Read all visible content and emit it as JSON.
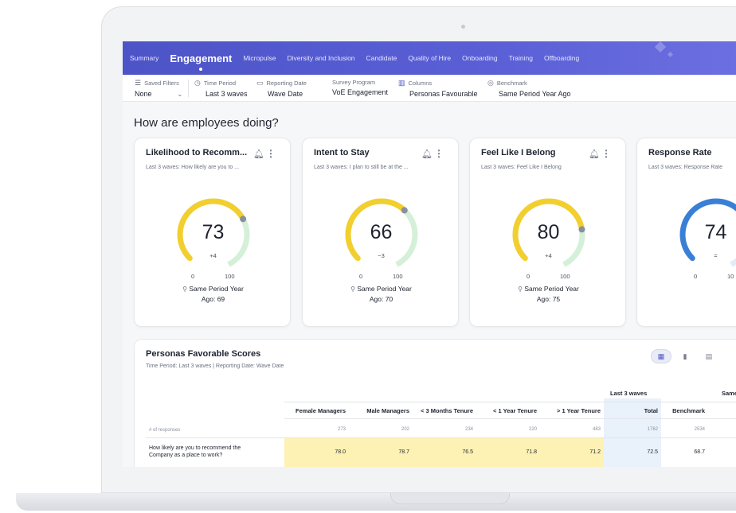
{
  "nav": {
    "items": [
      {
        "label": "Summary",
        "active": false
      },
      {
        "label": "Engagement",
        "active": true
      },
      {
        "label": "Micropulse",
        "active": false
      },
      {
        "label": "Diversity and Inclusion",
        "active": false
      },
      {
        "label": "Candidate",
        "active": false
      },
      {
        "label": "Quality of Hire",
        "active": false
      },
      {
        "label": "Onboarding",
        "active": false
      },
      {
        "label": "Training",
        "active": false
      },
      {
        "label": "Offboarding",
        "active": false
      }
    ]
  },
  "filters": {
    "saved_filters": {
      "label": "Saved Filters",
      "value": "None"
    },
    "time_period": {
      "label": "Time Period",
      "value": "Last 3 waves"
    },
    "reporting_date": {
      "label": "Reporting Date",
      "value": "Wave Date"
    },
    "survey_program": {
      "label": "Survey Program",
      "value": "VoE Engagement"
    },
    "columns": {
      "label": "Columns",
      "value": "Personas Favourable"
    },
    "benchmark": {
      "label": "Benchmark",
      "value": "Same Period Year Ago"
    }
  },
  "section_title": "How are employees doing?",
  "cards": [
    {
      "title": "Likelihood to Recomm...",
      "subtitle": "Last 3 waves: How likely are you to ...",
      "value": "73",
      "value_num": 73,
      "delta": "+4",
      "min": "0",
      "max": "100",
      "bench_line1": "Same Period Year",
      "bench_line2": "Ago: 69",
      "color": "#f2cf2e"
    },
    {
      "title": "Intent to Stay",
      "subtitle": "Last 3 waves: I plan to still be at the ...",
      "value": "66",
      "value_num": 66,
      "delta": "−3",
      "min": "0",
      "max": "100",
      "bench_line1": "Same Period Year",
      "bench_line2": "Ago: 70",
      "color": "#f2cf2e"
    },
    {
      "title": "Feel Like I Belong",
      "subtitle": "Last 3 waves: Feel Like I Belong",
      "value": "80",
      "value_num": 80,
      "delta": "+4",
      "min": "0",
      "max": "100",
      "bench_line1": "Same Period Year",
      "bench_line2": "Ago: 75",
      "color": "#f2cf2e"
    },
    {
      "title": "Response Rate",
      "subtitle": "Last 3 waves: Response Rate",
      "value": "74",
      "value_num": 74,
      "delta": "=",
      "min": "0",
      "max": "10",
      "bench_line1": "",
      "bench_line2": "",
      "color": "#3a7fd6"
    }
  ],
  "table": {
    "title": "Personas Favorable Scores",
    "subtitle": "Time Period: Last 3 waves | Reporting Date: Wave Date",
    "group_last_waves": "Last 3 waves",
    "group_same_period": "Same Pe",
    "columns": [
      "Female Managers",
      "Male Managers",
      "< 3 Months Tenure",
      "< 1 Year Tenure",
      "> 1 Year Tenure",
      "Total",
      "Benchmark"
    ],
    "responses_label": "# of responses",
    "responses": [
      "273",
      "202",
      "234",
      "220",
      "483",
      "1762",
      "2534"
    ],
    "row1_label_line1": "How likely are you to recommend the",
    "row1_label_line2": "Company as a place to work?",
    "row1": [
      "78.0",
      "78.7",
      "76.5",
      "71.8",
      "71.2",
      "72.5",
      "68.7"
    ]
  },
  "icons": {
    "filter": "filter-icon",
    "clock": "clock-icon",
    "calendar": "calendar-icon",
    "columns": "columns-icon",
    "benchmark": "target-icon",
    "bell": "bell-icon",
    "more": "more-vertical-icon",
    "pin": "map-pin-icon"
  },
  "colors": {
    "nav": "#5a5fd6",
    "gauge_yellow": "#f2cf2e",
    "gauge_track": "#d5f0d8",
    "gauge_blue": "#3a7fd6",
    "highlight_yellow": "#fdf2b3",
    "total_blue": "#e9f1fb"
  }
}
